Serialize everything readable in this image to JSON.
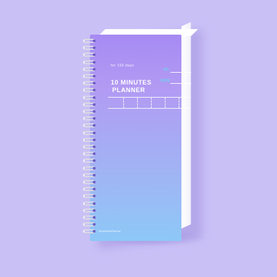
{
  "planner": {
    "tagline": "for 100 days",
    "title_line1": "10 MINUTES",
    "title_line2": "PLANNER",
    "field_no": "NO.",
    "field_date": "DATE",
    "brand": "10minutesPlanner"
  },
  "colors": {
    "background": "#c9c0f6",
    "cover_top": "#a68af3",
    "cover_bottom": "#8dc8f7",
    "field_label": "#69d4f0",
    "ring": "#d8d8e4"
  },
  "ring_count": 28
}
